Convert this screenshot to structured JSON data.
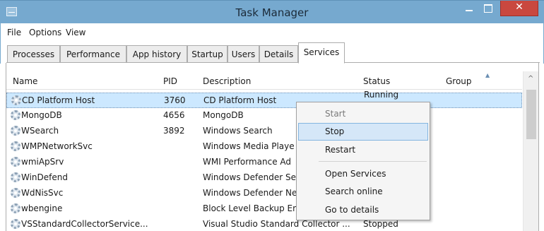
{
  "window": {
    "title": "Task Manager",
    "close_glyph": "✕",
    "app_icon": "task-manager-icon"
  },
  "menubar": {
    "items": [
      "File",
      "Options",
      "View"
    ]
  },
  "tabs": [
    {
      "label": "Processes",
      "active": false
    },
    {
      "label": "Performance",
      "active": false
    },
    {
      "label": "App history",
      "active": false
    },
    {
      "label": "Startup",
      "active": false
    },
    {
      "label": "Users",
      "active": false
    },
    {
      "label": "Details",
      "active": false
    },
    {
      "label": "Services",
      "active": true
    }
  ],
  "table": {
    "columns": [
      "Name",
      "PID",
      "Description",
      "Status",
      "Group"
    ],
    "sort_indicator": "▲",
    "rows": [
      {
        "name": "CD Platform Host",
        "pid": "3760",
        "description": "CD Platform Host",
        "status": "Running",
        "group": "",
        "selected": true
      },
      {
        "name": "MongoDB",
        "pid": "4656",
        "description": "MongoDB",
        "status": "",
        "group": ""
      },
      {
        "name": "WSearch",
        "pid": "3892",
        "description": "Windows Search",
        "status": "",
        "group": ""
      },
      {
        "name": "WMPNetworkSvc",
        "pid": "",
        "description": "Windows Media Playe",
        "status": "",
        "group": ""
      },
      {
        "name": "wmiApSrv",
        "pid": "",
        "description": "WMI Performance Ad",
        "status": "",
        "group": ""
      },
      {
        "name": "WinDefend",
        "pid": "",
        "description": "Windows Defender Se",
        "status": "",
        "group": ""
      },
      {
        "name": "WdNisSvc",
        "pid": "",
        "description": "Windows Defender Ne",
        "status": "",
        "group": ""
      },
      {
        "name": "wbengine",
        "pid": "",
        "description": "Block Level Backup Er",
        "status": "",
        "group": ""
      },
      {
        "name": "VSStandardCollectorService...",
        "pid": "",
        "description": "Visual Studio Standard Collector ...",
        "status": "Stopped",
        "group": ""
      }
    ]
  },
  "scrollbar": {
    "up_glyph": "^"
  },
  "context_menu": {
    "items": [
      {
        "label": "Start",
        "state": "disabled"
      },
      {
        "label": "Stop",
        "state": "highlighted"
      },
      {
        "label": "Restart",
        "state": "normal"
      },
      {
        "label": "Open Services",
        "state": "normal"
      },
      {
        "label": "Search online",
        "state": "normal"
      },
      {
        "label": "Go to details",
        "state": "normal"
      }
    ]
  }
}
